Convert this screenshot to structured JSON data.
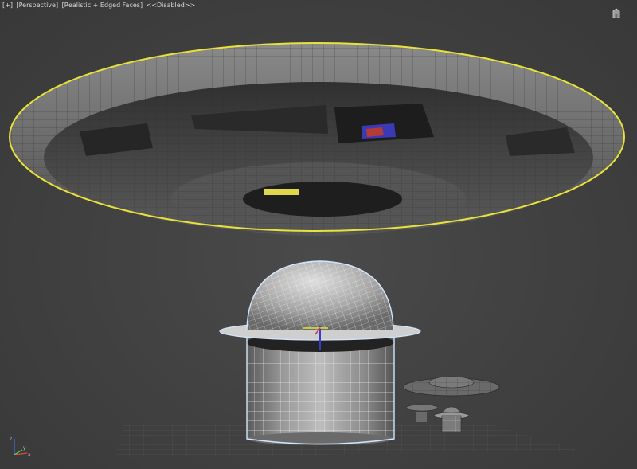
{
  "viewport": {
    "labels": {
      "plus": "[+]",
      "view": "[Perspective]",
      "shading": "[Realistic + Edged Faces]",
      "disabled": "<<Disabled>>"
    },
    "viewcube_icon": "home-cube-icon",
    "axis_labels": {
      "x": "x",
      "y": "y",
      "z": "z"
    }
  },
  "colors": {
    "background": "#444444",
    "selection_outline": "#e8e23a",
    "highlight_outline": "#cfe8ff",
    "mesh_edge": "#1a1a1a",
    "grid": "#5a5a5a"
  }
}
